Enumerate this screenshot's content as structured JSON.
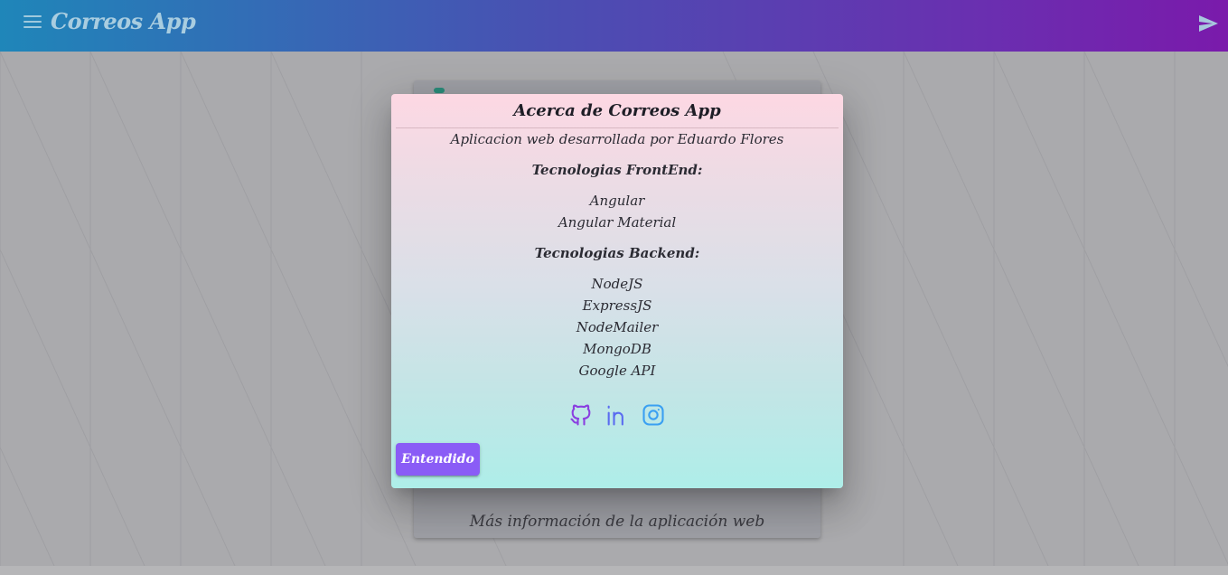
{
  "toolbar": {
    "title": "Correos App",
    "menu_icon": "menu-icon",
    "send_icon": "send-icon"
  },
  "background_card": {
    "caption": "Más información de la aplicación web"
  },
  "dialog": {
    "title": "Acerca de Correos App",
    "subtitle": "Aplicacion web desarrollada por Eduardo Flores",
    "frontend_heading": "Tecnologias FrontEnd:",
    "frontend_items": [
      "Angular",
      "Angular Material"
    ],
    "backend_heading": "Tecnologias Backend:",
    "backend_items": [
      "NodeJS",
      "ExpressJS",
      "NodeMailer",
      "MongoDB",
      "Google API"
    ],
    "social_icons": [
      "github-icon",
      "linkedin-icon",
      "instagram-icon"
    ],
    "confirm_label": "Entendido"
  },
  "colors": {
    "toolbar_start": "#1f86b9",
    "toolbar_end": "#7a1aab",
    "button": "#8a5cf6",
    "github": "#8a3fe0",
    "linkedin": "#5a6cf0",
    "instagram": "#3aa0f2"
  }
}
